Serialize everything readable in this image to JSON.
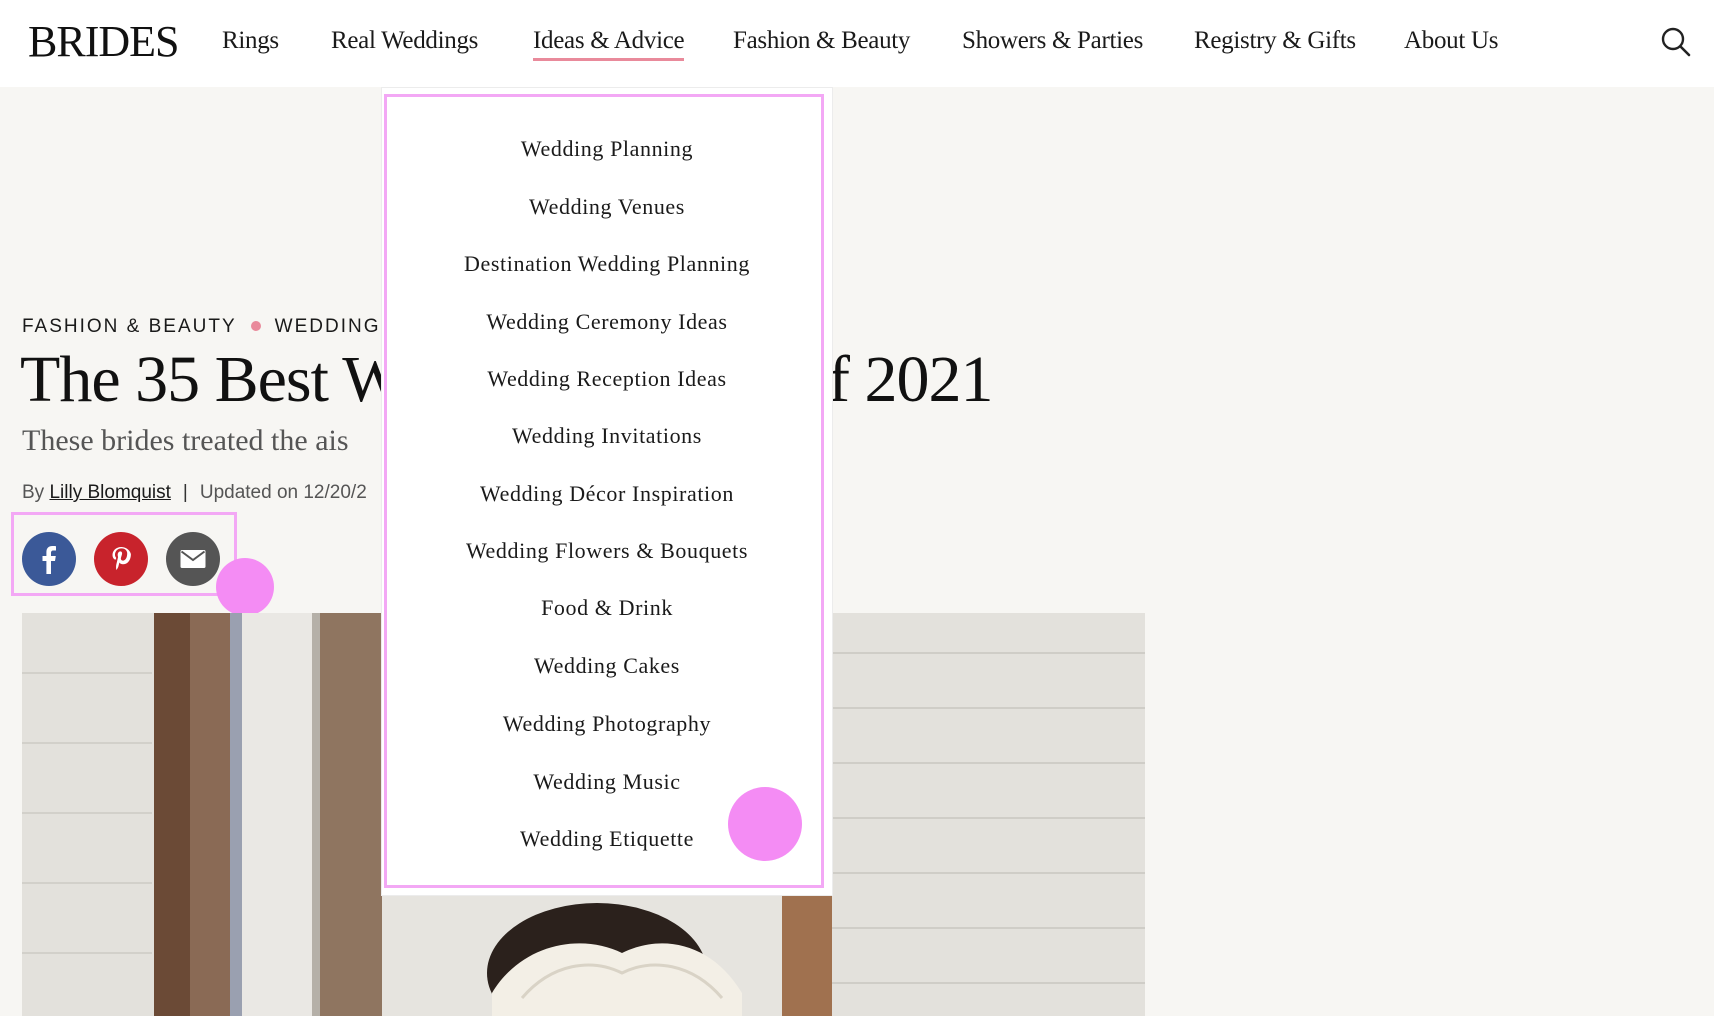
{
  "header": {
    "logo": "BRIDES",
    "nav": [
      {
        "label": "Rings",
        "active": false
      },
      {
        "label": "Real Weddings",
        "active": false
      },
      {
        "label": "Ideas & Advice",
        "active": true
      },
      {
        "label": "Fashion & Beauty",
        "active": false
      },
      {
        "label": "Showers & Parties",
        "active": false
      },
      {
        "label": "Registry & Gifts",
        "active": false
      },
      {
        "label": "About Us",
        "active": false
      }
    ],
    "search_icon": "search-icon"
  },
  "dropdown": {
    "items": [
      "Wedding Planning",
      "Wedding Venues",
      "Destination Wedding Planning",
      "Wedding Ceremony Ideas",
      "Wedding Reception Ideas",
      "Wedding Invitations",
      "Wedding Décor Inspiration",
      "Wedding Flowers & Bouquets",
      "Food & Drink",
      "Wedding Cakes",
      "Wedding Photography",
      "Wedding Music",
      "Wedding Etiquette"
    ]
  },
  "article": {
    "eyebrow_1": "FASHION & BEAUTY",
    "eyebrow_2": "WEDDING",
    "title_left": "The 35 Best W",
    "title_right": "f 2021",
    "subtitle": "These brides treated the ais",
    "byline_prefix": "By",
    "author": "Lilly Blomquist",
    "byline_sep": "|",
    "updated": "Updated on 12/20/2"
  },
  "social": {
    "icons": [
      "facebook-icon",
      "pinterest-icon",
      "email-icon"
    ]
  },
  "colors": {
    "accent": "#e98a9b",
    "facebook": "#3b5998",
    "pinterest": "#c8232c",
    "email": "#555555",
    "highlight": "#f3a8f5"
  }
}
